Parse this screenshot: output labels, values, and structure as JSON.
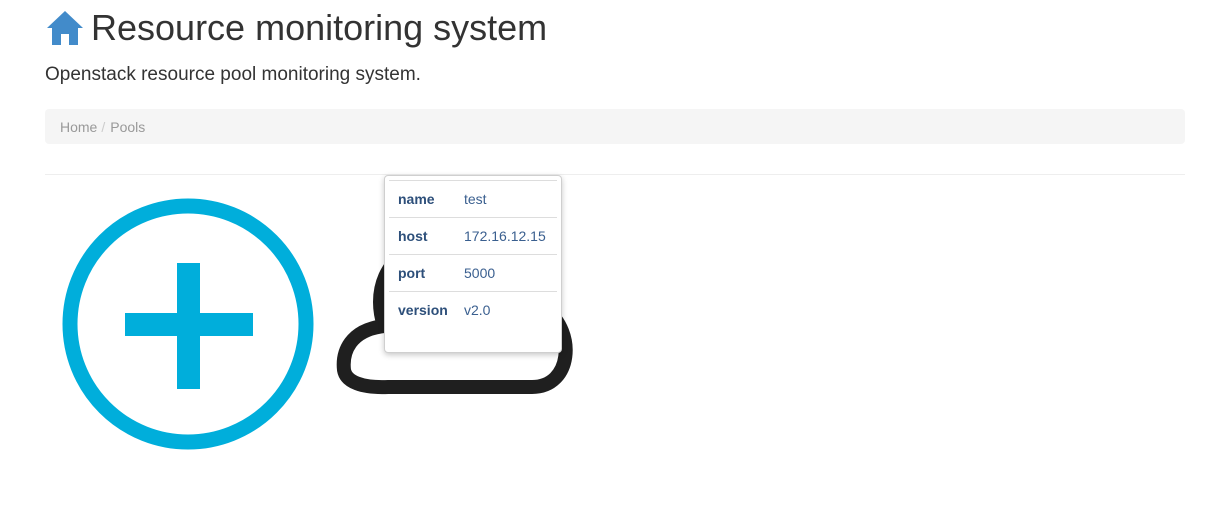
{
  "header": {
    "title": "Resource monitoring system",
    "icon": "home-icon",
    "subtitle": "Openstack resource pool monitoring system."
  },
  "breadcrumb": {
    "items": [
      {
        "label": "Home"
      },
      {
        "label": "Pools"
      }
    ],
    "separator": "/"
  },
  "pools": {
    "add_icon": "plus-circle-icon",
    "pool_icon": "cloud-icon",
    "colors": {
      "add": "#00aedb",
      "cloud": "#1f1f1f"
    },
    "popover": {
      "rows": [
        {
          "key": "name",
          "value": "test"
        },
        {
          "key": "host",
          "value": "172.16.12.15"
        },
        {
          "key": "port",
          "value": "5000"
        },
        {
          "key": "version",
          "value": "v2.0"
        }
      ]
    }
  },
  "colors": {
    "home_icon": "#428bca",
    "breadcrumb_bg": "#f5f5f5"
  }
}
